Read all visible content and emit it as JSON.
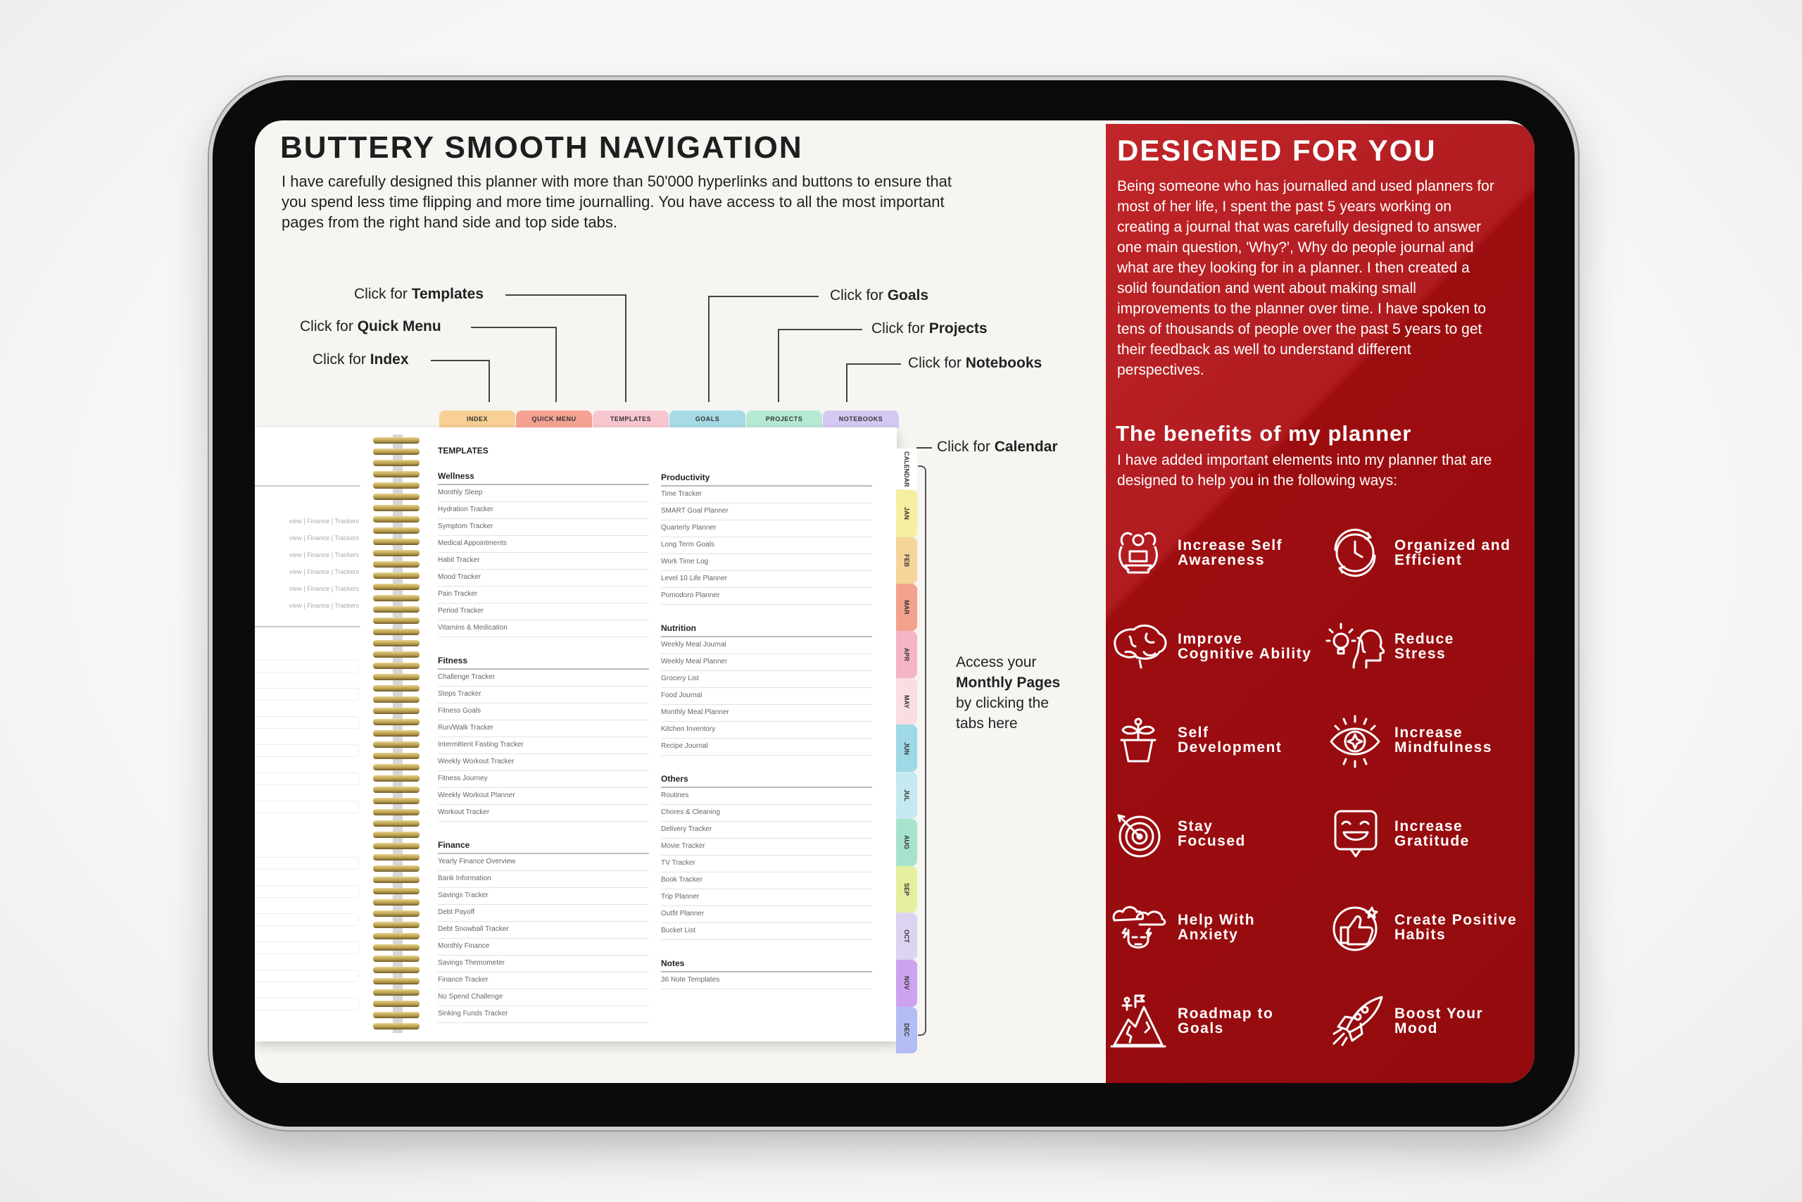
{
  "left": {
    "title": "BUTTERY SMOOTH NAVIGATION",
    "intro": "I have carefully designed this planner with more than 50'000 hyperlinks and buttons to ensure that you spend less time flipping and more time journalling. You have access to all the most important pages from the right hand side and top side tabs.",
    "callouts": {
      "prefix": "Click for ",
      "templates": "Templates",
      "quick_menu": "Quick Menu",
      "index": "Index",
      "goals": "Goals",
      "projects": "Projects",
      "notebooks": "Notebooks",
      "calendar": "Calendar"
    },
    "monthly": {
      "l1": "Access your",
      "l2": "Monthly Pages",
      "l3": "by clicking the",
      "l4": "tabs here"
    }
  },
  "notebook": {
    "top_tabs": [
      {
        "label": "INDEX",
        "color": "#f8cf95"
      },
      {
        "label": "QUICK MENU",
        "color": "#f5a292"
      },
      {
        "label": "TEMPLATES",
        "color": "#f8c6cf"
      },
      {
        "label": "GOALS",
        "color": "#a6dbe6"
      },
      {
        "label": "PROJECTS",
        "color": "#b6ead5"
      },
      {
        "label": "NOTEBOOKS",
        "color": "#d4c9f3"
      }
    ],
    "calendar_tab": "CALENDAR",
    "month_tabs": [
      {
        "label": "JAN",
        "color": "#f6eea0"
      },
      {
        "label": "FEB",
        "color": "#f7d49a"
      },
      {
        "label": "MAR",
        "color": "#f4a18e"
      },
      {
        "label": "APR",
        "color": "#f6b5c4"
      },
      {
        "label": "MAY",
        "color": "#f9dde3"
      },
      {
        "label": "JUN",
        "color": "#9fd9e6"
      },
      {
        "label": "JUL",
        "color": "#c6e9f0"
      },
      {
        "label": "AUG",
        "color": "#a7e3cc"
      },
      {
        "label": "SEP",
        "color": "#e6efa0"
      },
      {
        "label": "OCT",
        "color": "#dcd3f3"
      },
      {
        "label": "NOV",
        "color": "#cda3ee"
      },
      {
        "label": "DEC",
        "color": "#b3bdf3"
      }
    ],
    "left_page_row": "view  |  Finance  |  Trackers",
    "heading": "TEMPLATES",
    "columns": [
      [
        {
          "title": "Wellness",
          "items": [
            "Monthly Sleep",
            "Hydration Tracker",
            "Symptom Tracker",
            "Medical Appointments",
            "Habit Tracker",
            "Mood Tracker",
            "Pain Tracker",
            "Period Tracker",
            "Vitamins & Medication"
          ]
        },
        {
          "title": "Fitness",
          "items": [
            "Challenge Tracker",
            "Steps Tracker",
            "Fitness Goals",
            "Run/Walk Tracker",
            "Intermittent Fasting Tracker",
            "Weekly Workout Tracker",
            "Fitness Journey",
            "Weekly Workout Planner",
            "Workout Tracker"
          ]
        },
        {
          "title": "Finance",
          "items": [
            "Yearly Finance Overview",
            "Bank Information",
            "Savings Tracker",
            "Debt Payoff",
            "Debt Snowball Tracker",
            "Monthly Finance",
            "Savings Themometer",
            "Finance Tracker",
            "No Spend Challenge",
            "Sinking Funds Tracker"
          ]
        }
      ],
      [
        {
          "title": "Productivity",
          "items": [
            "Time Tracker",
            "SMART Goal Planner",
            "Quarterly Planner",
            "Long Term Goals",
            "Work Time Log",
            "Level 10 Life Planner",
            "Pomodoro Planner"
          ]
        },
        {
          "title": "Nutrition",
          "items": [
            "Weekly Meal Journal",
            "Weekly Meal Planner",
            "Grocery List",
            "Food Journal",
            "Monthly Meal Planner",
            "Kitchen Inventory",
            "Recipe Journal"
          ]
        },
        {
          "title": "Others",
          "items": [
            "Routines",
            "Chores & Cleaning",
            "Delivery Tracker",
            "Movie Tracker",
            "TV Tracker",
            "Book Tracker",
            "Trip Planner",
            "Outfit Planner",
            "Bucket List"
          ]
        },
        {
          "title": "Notes",
          "items": [
            "36 Note Templates"
          ]
        }
      ]
    ]
  },
  "right": {
    "accent": "#a81418",
    "title": "DESIGNED FOR YOU",
    "para": "Being someone who has journalled and used planners for most of her life, I spent the past 5 years working on creating a journal that was carefully designed to answer one main question, 'Why?', Why do people journal and what are they looking for in a planner. I then created a solid foundation and went about making small improvements to the planner over time. I have spoken to tens of thousands of people over the past 5 years to get their feedback as well to understand different perspectives.",
    "benefits_title": "The benefits of my planner",
    "benefits_intro": "I have added important elements into my planner that are designed to help you in the following ways:",
    "benefits": [
      {
        "label": "Increase Self\nAwareness",
        "icon": "meditation-icon"
      },
      {
        "label": "Organized and\nEfficient",
        "icon": "clock-cycle-icon"
      },
      {
        "label": "Improve\nCognitive Ability",
        "icon": "brain-icon"
      },
      {
        "label": "Reduce\nStress",
        "icon": "head-lightbulb-icon"
      },
      {
        "label": "Self\nDevelopment",
        "icon": "plant-pot-icon"
      },
      {
        "label": "Increase\nMindfulness",
        "icon": "eye-icon"
      },
      {
        "label": "Stay\nFocused",
        "icon": "target-icon"
      },
      {
        "label": "Increase\nGratitude",
        "icon": "smile-bubble-icon"
      },
      {
        "label": "Help With\nAnxiety",
        "icon": "storm-head-icon"
      },
      {
        "label": "Create Positive\nHabits",
        "icon": "thumbs-up-icon"
      },
      {
        "label": "Roadmap to\nGoals",
        "icon": "mountain-flag-icon"
      },
      {
        "label": "Boost Your\nMood",
        "icon": "rocket-icon"
      }
    ]
  }
}
